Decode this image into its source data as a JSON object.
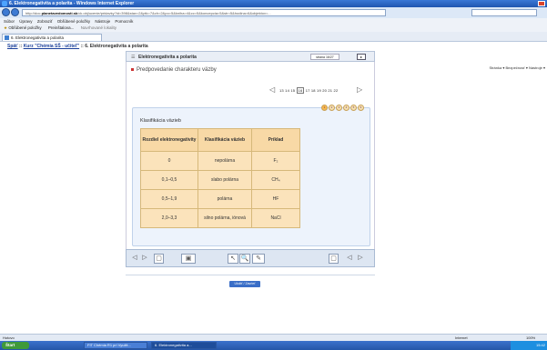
{
  "window": {
    "title": "6. Elektronegativita a polarita - Windows Internet Explorer"
  },
  "address": {
    "url_prefix": "http://doc.",
    "url_domain": "planetavedomosti.sk",
    "url_rest": "/ck.obj/ucenie/pridavky?id=398&stav=2&ptk=7&ch=2&po=5&kniha=4&cc=5&koncepcia=5&str=5&hodina=6&objektov=..."
  },
  "menu": [
    "Súbor",
    "Úpravy",
    "Zobraziť",
    "Obľúbené položky",
    "Nástroje",
    "Pomocník"
  ],
  "favorites": {
    "label": "Obľúbené položky",
    "items": [
      "Preinštalova...",
      "Navrhované lokality"
    ]
  },
  "tab": {
    "label": "6. Elektronegativita a polarita"
  },
  "commandbar": {
    "text": "Stránka ▾  Bezpečnosť ▾  Nástroje ▾"
  },
  "breadcrumb": {
    "back": "Späť",
    "sep1": " :: ",
    "course": "Kurz \"Chémia SŠ - učiteľ\"",
    "sep2": " :: ",
    "current": "6. Elektronegativita a polarita"
  },
  "lesson": {
    "title": "Elektronegativita a polarita",
    "page_label": "strana 16/27",
    "next_glyph": "▸",
    "menu_glyph": "☰"
  },
  "section": {
    "title": "Predpovedanie charakteru väzby"
  },
  "pages": {
    "prev": "◁",
    "next": "▷",
    "numbers": [
      "13",
      "14",
      "15"
    ],
    "current": "16",
    "after": [
      "17",
      "18",
      "19",
      "20",
      "21",
      "22"
    ]
  },
  "steps": [
    "1",
    "2",
    "3",
    "4",
    "5",
    "6"
  ],
  "table": {
    "caption": "Klasifikácia väzieb",
    "headers": [
      "Rozdiel elektronegativity",
      "Klasifikácia väzieb",
      "Príklad"
    ],
    "rows": [
      [
        "0",
        "nepolárna",
        "F₂"
      ],
      [
        "0,1–0,5",
        "slabo polárna",
        "CH₄"
      ],
      [
        "0,5–1,9",
        "polárna",
        "HF"
      ],
      [
        "2,0–3,3",
        "silno polárna, iónová",
        "NaCl"
      ]
    ]
  },
  "controls": {
    "prev": "◁",
    "next": "▷",
    "home": "⌂",
    "save": "▣",
    "cursor": "↖",
    "zoom": "🔍",
    "pen": "✎",
    "next2": "▷",
    "prev2": "◁",
    "box": "▢"
  },
  "submit": {
    "label": "Uložiť / Zavrieť"
  },
  "status": {
    "left": "Hotovo",
    "zone": "Internet",
    "zoom": "100%"
  },
  "taskbar": {
    "start": "Štart",
    "items": [
      "FIT Chémia R1 pri Využit...",
      "6. Elektronegativita a..."
    ],
    "clock": "15:42"
  }
}
